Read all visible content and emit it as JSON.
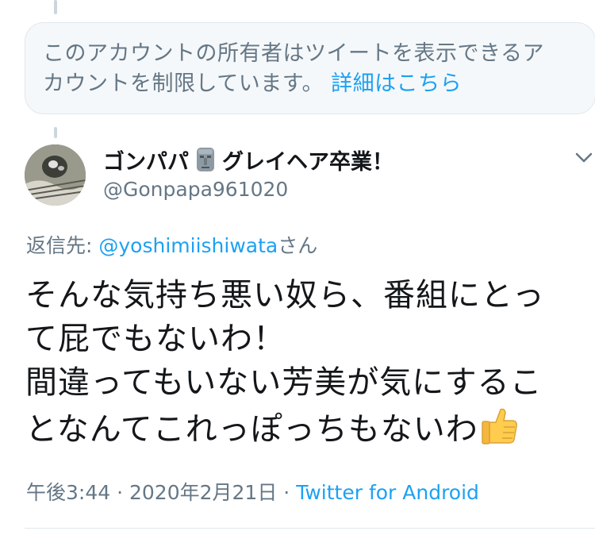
{
  "notice": {
    "text_line1": "このアカウントの所有者はツイートを表示できるア",
    "text_line2": "カウントを制限しています。",
    "link": "詳細はこちら"
  },
  "tweet": {
    "author_name_part1": "ゴンパパ",
    "author_name_part2": "グレイヘア卒業！",
    "name_icon": "moai-icon",
    "handle": "@Gonpapa961020",
    "reply_label": "返信先: ",
    "reply_mention": "@yoshimiishiwata",
    "reply_suffix": "さん",
    "lines": [
      "そんな気持ち悪い奴ら、番組にとっ",
      "て屁でもないわ！",
      "間違ってもいない芳美が気にするこ",
      "となんてこれっぽっちもないわ"
    ],
    "trailing_emoji": "thumbs-up-icon",
    "time": "午後3:44",
    "date": "2020年2月21日",
    "separator": "·",
    "source": "Twitter for Android"
  },
  "colors": {
    "accent": "#1da1f2",
    "secondary_text": "#657786",
    "primary_text": "#14171a"
  }
}
